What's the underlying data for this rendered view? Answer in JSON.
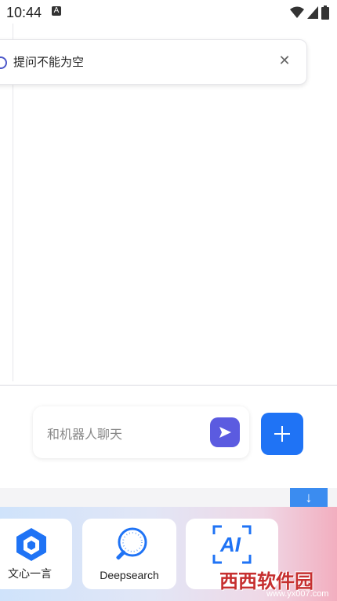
{
  "status_bar": {
    "time": "10:44",
    "indicator": "A",
    "icons": [
      "wifi-icon",
      "signal-icon",
      "battery-icon"
    ]
  },
  "toast": {
    "message": "提问不能为空",
    "close_symbol": "✕"
  },
  "composer": {
    "placeholder": "和机器人聊天",
    "send_icon": "send-icon",
    "add_icon": "plus-icon"
  },
  "scroll_down": {
    "symbol": "↓"
  },
  "apps": [
    {
      "label": "文心一言",
      "icon": "wenxin-logo-icon"
    },
    {
      "label": "Deepsearch",
      "icon": "magnifier-icon"
    },
    {
      "label": "AI",
      "icon": "ai-scan-icon"
    }
  ],
  "watermark": {
    "brand": "西西软件园",
    "url": "www.yx007.com"
  },
  "colors": {
    "accent_blue": "#1f73f5",
    "send_purple": "#5b5be0",
    "watermark_red": "#c62f2f"
  }
}
